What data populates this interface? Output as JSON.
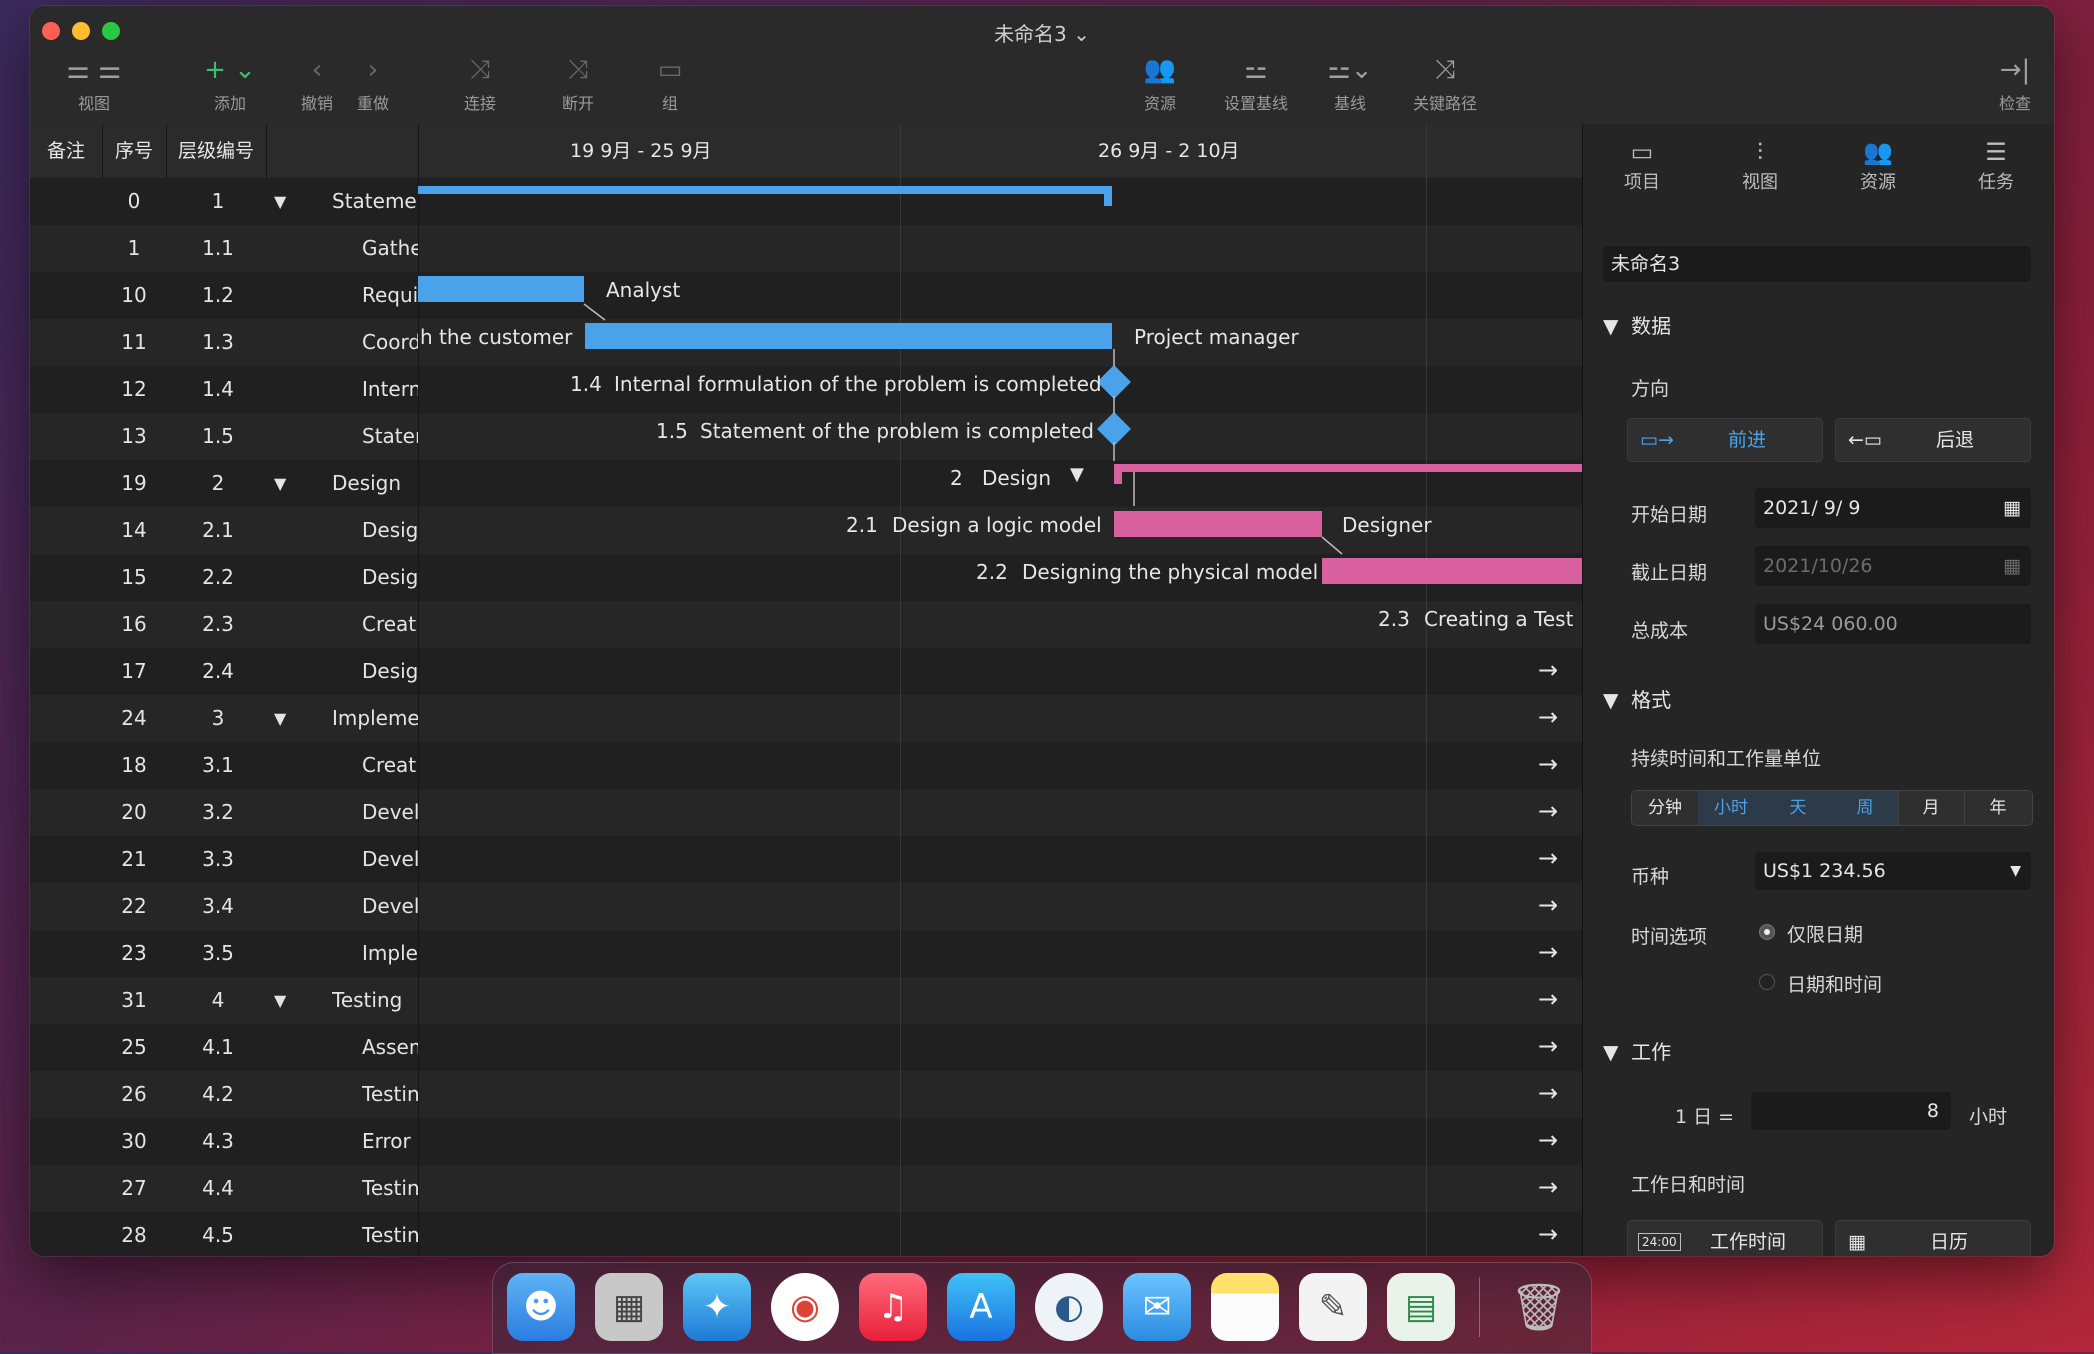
{
  "window": {
    "title": "未命名3"
  },
  "toolbar": {
    "view": "视图",
    "add": "添加",
    "undo": "撤销",
    "redo": "重做",
    "link": "连接",
    "unlink": "断开",
    "group": "组",
    "resources": "资源",
    "set_baseline": "设置基线",
    "baseline": "基线",
    "critical_path": "关键路径",
    "inspect": "检查"
  },
  "table": {
    "headers": {
      "notes": "备注",
      "seq": "序号",
      "wbs": "层级编号"
    },
    "periods": [
      "19 9月 - 25 9月",
      "26 9月 - 2 10月"
    ],
    "rows": [
      {
        "seq": "0",
        "wbs": "1",
        "name": "Statement c",
        "group": true
      },
      {
        "seq": "1",
        "wbs": "1.1",
        "name": "Gatherin"
      },
      {
        "seq": "10",
        "wbs": "1.2",
        "name": "Requiren"
      },
      {
        "seq": "11",
        "wbs": "1.3",
        "name": "Coordina"
      },
      {
        "seq": "12",
        "wbs": "1.4",
        "name": "Internal f"
      },
      {
        "seq": "13",
        "wbs": "1.5",
        "name": "Stateme"
      },
      {
        "seq": "19",
        "wbs": "2",
        "name": "Design",
        "group": true
      },
      {
        "seq": "14",
        "wbs": "2.1",
        "name": "Design a"
      },
      {
        "seq": "15",
        "wbs": "2.2",
        "name": "Designin"
      },
      {
        "seq": "16",
        "wbs": "2.3",
        "name": "Creating"
      },
      {
        "seq": "17",
        "wbs": "2.4",
        "name": "Design is"
      },
      {
        "seq": "24",
        "wbs": "3",
        "name": "Implementa",
        "group": true
      },
      {
        "seq": "18",
        "wbs": "3.1",
        "name": "Creating"
      },
      {
        "seq": "20",
        "wbs": "3.2",
        "name": "Develop"
      },
      {
        "seq": "21",
        "wbs": "3.3",
        "name": "Develop"
      },
      {
        "seq": "22",
        "wbs": "3.4",
        "name": "Develop"
      },
      {
        "seq": "23",
        "wbs": "3.5",
        "name": "Impleme"
      },
      {
        "seq": "31",
        "wbs": "4",
        "name": "Testing",
        "group": true
      },
      {
        "seq": "25",
        "wbs": "4.1",
        "name": "Assembl"
      },
      {
        "seq": "26",
        "wbs": "4.2",
        "name": "Testing -"
      },
      {
        "seq": "30",
        "wbs": "4.3",
        "name": "Error cor"
      },
      {
        "seq": "27",
        "wbs": "4.4",
        "name": "Testing -"
      },
      {
        "seq": "28",
        "wbs": "4.5",
        "name": "Testing c"
      }
    ]
  },
  "gantt": {
    "analyst": "Analyst",
    "coord_rest": "h the customer",
    "project_manager": "Project manager",
    "m14_num": "1.4",
    "m14_text": "Internal formulation of the problem is completed",
    "m15_num": "1.5",
    "m15_text": "Statement of the problem is completed",
    "design_num": "2",
    "design_text": "Design",
    "t21_num": "2.1",
    "t21_text": "Design a logic model",
    "designer": "Designer",
    "t22_num": "2.2",
    "t22_text": "Designing the physical model",
    "t23_num": "2.3",
    "t23_text": "Creating a Test I",
    "colors": {
      "blue": "#4aa3ea",
      "pink": "#d9609e"
    }
  },
  "panel": {
    "tabs": [
      "项目",
      "视图",
      "资源",
      "任务"
    ],
    "project_name": "未命名3",
    "data_section": "数据",
    "direction_label": "方向",
    "forward": "前进",
    "backward": "后退",
    "start_label": "开始日期",
    "start_value": "2021/ 9/ 9",
    "end_label": "截止日期",
    "end_value": "2021/10/26",
    "cost_label": "总成本",
    "cost_value": "US$24 060.00",
    "format_section": "格式",
    "units_label": "持续时间和工作量单位",
    "units": [
      "分钟",
      "小时",
      "天",
      "周",
      "月",
      "年"
    ],
    "currency_label": "币种",
    "currency_value": "US$1 234.56",
    "time_label": "时间选项",
    "time_opt1": "仅限日期",
    "time_opt2": "日期和时间",
    "work_section": "工作",
    "day_eq": "1 日 =",
    "day_hours": "8",
    "hours_unit": "小时",
    "work_days_label": "工作日和时间",
    "work_time_btn": "工作时间",
    "work_time_icon": "24:00",
    "calendar_btn": "日历"
  },
  "dock": [
    "finder",
    "launchpad",
    "safari",
    "chrome",
    "music",
    "app-store",
    "edge",
    "mail",
    "notes",
    "textedit",
    "project-app",
    "trash"
  ]
}
